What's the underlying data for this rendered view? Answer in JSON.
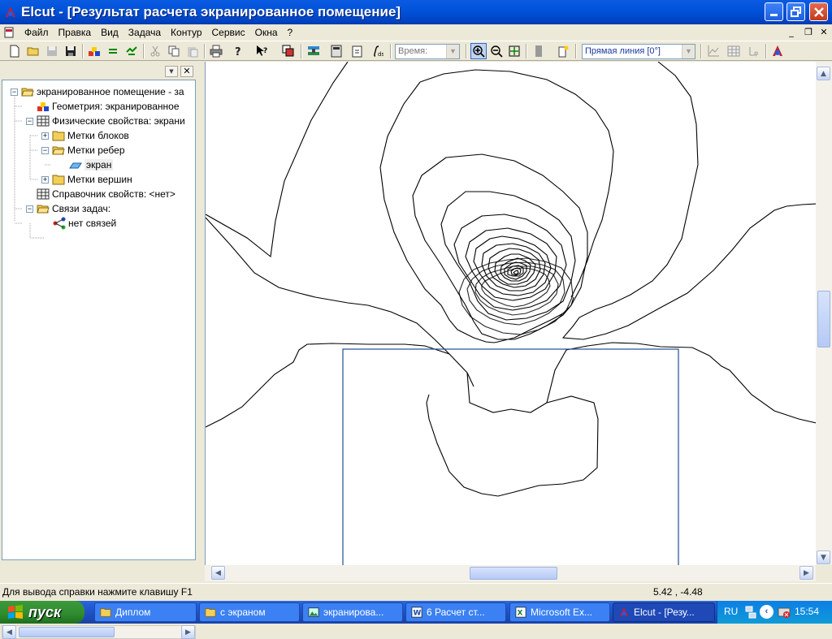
{
  "window": {
    "title": "Elcut - [Результат расчета экранированное помещение]"
  },
  "menu": {
    "items": [
      "Файл",
      "Правка",
      "Вид",
      "Задача",
      "Контур",
      "Сервис",
      "Окна",
      "?"
    ]
  },
  "toolbar": {
    "time_combo": "Время:",
    "line_combo": "Прямая линия [0°]"
  },
  "tree": {
    "items": [
      {
        "label": "экранированное помещение - за",
        "level": 0,
        "expander": "−",
        "icon": "folder-open-icon"
      },
      {
        "label": "Геометрия: экранированное",
        "level": 1,
        "expander": "",
        "icon": "geometry-icon"
      },
      {
        "label": "Физические свойства: экрани",
        "level": 1,
        "expander": "−",
        "icon": "table-icon"
      },
      {
        "label": "Метки блоков",
        "level": 2,
        "expander": "+",
        "icon": "folder-icon"
      },
      {
        "label": "Метки ребер",
        "level": 2,
        "expander": "−",
        "icon": "folder-open-icon"
      },
      {
        "label": "экран",
        "level": 3,
        "expander": "",
        "icon": "edge-label-icon",
        "selected": true
      },
      {
        "label": "Метки вершин",
        "level": 2,
        "expander": "+",
        "icon": "folder-icon"
      },
      {
        "label": "Справочник свойств: <нет>",
        "level": 1,
        "expander": "",
        "icon": "table-icon"
      },
      {
        "label": "Связи задач:",
        "level": 1,
        "expander": "−",
        "icon": "folder-open-icon"
      },
      {
        "label": "нет связей",
        "level": 2,
        "expander": "",
        "icon": "links-icon"
      }
    ]
  },
  "status": {
    "hint": "Для вывода справки нажмите клавишу F1",
    "coords": "5.42 , -4.48"
  },
  "taskbar": {
    "start": "пуск",
    "tasks": [
      {
        "label": "Диплом",
        "icon": "folder-icon"
      },
      {
        "label": "с экраном",
        "icon": "folder-icon"
      },
      {
        "label": "экранирова...",
        "icon": "image-icon"
      },
      {
        "label": "6  Расчет ст...",
        "icon": "word-icon"
      },
      {
        "label": "Microsoft Ex...",
        "icon": "excel-icon"
      },
      {
        "label": "Elcut - [Резу...",
        "icon": "elcut-icon",
        "active": true
      }
    ],
    "lang": "RU",
    "clock": "15:54"
  },
  "colors": {
    "accent": "#0a5be0",
    "screen_rect": "#1f4e96"
  }
}
